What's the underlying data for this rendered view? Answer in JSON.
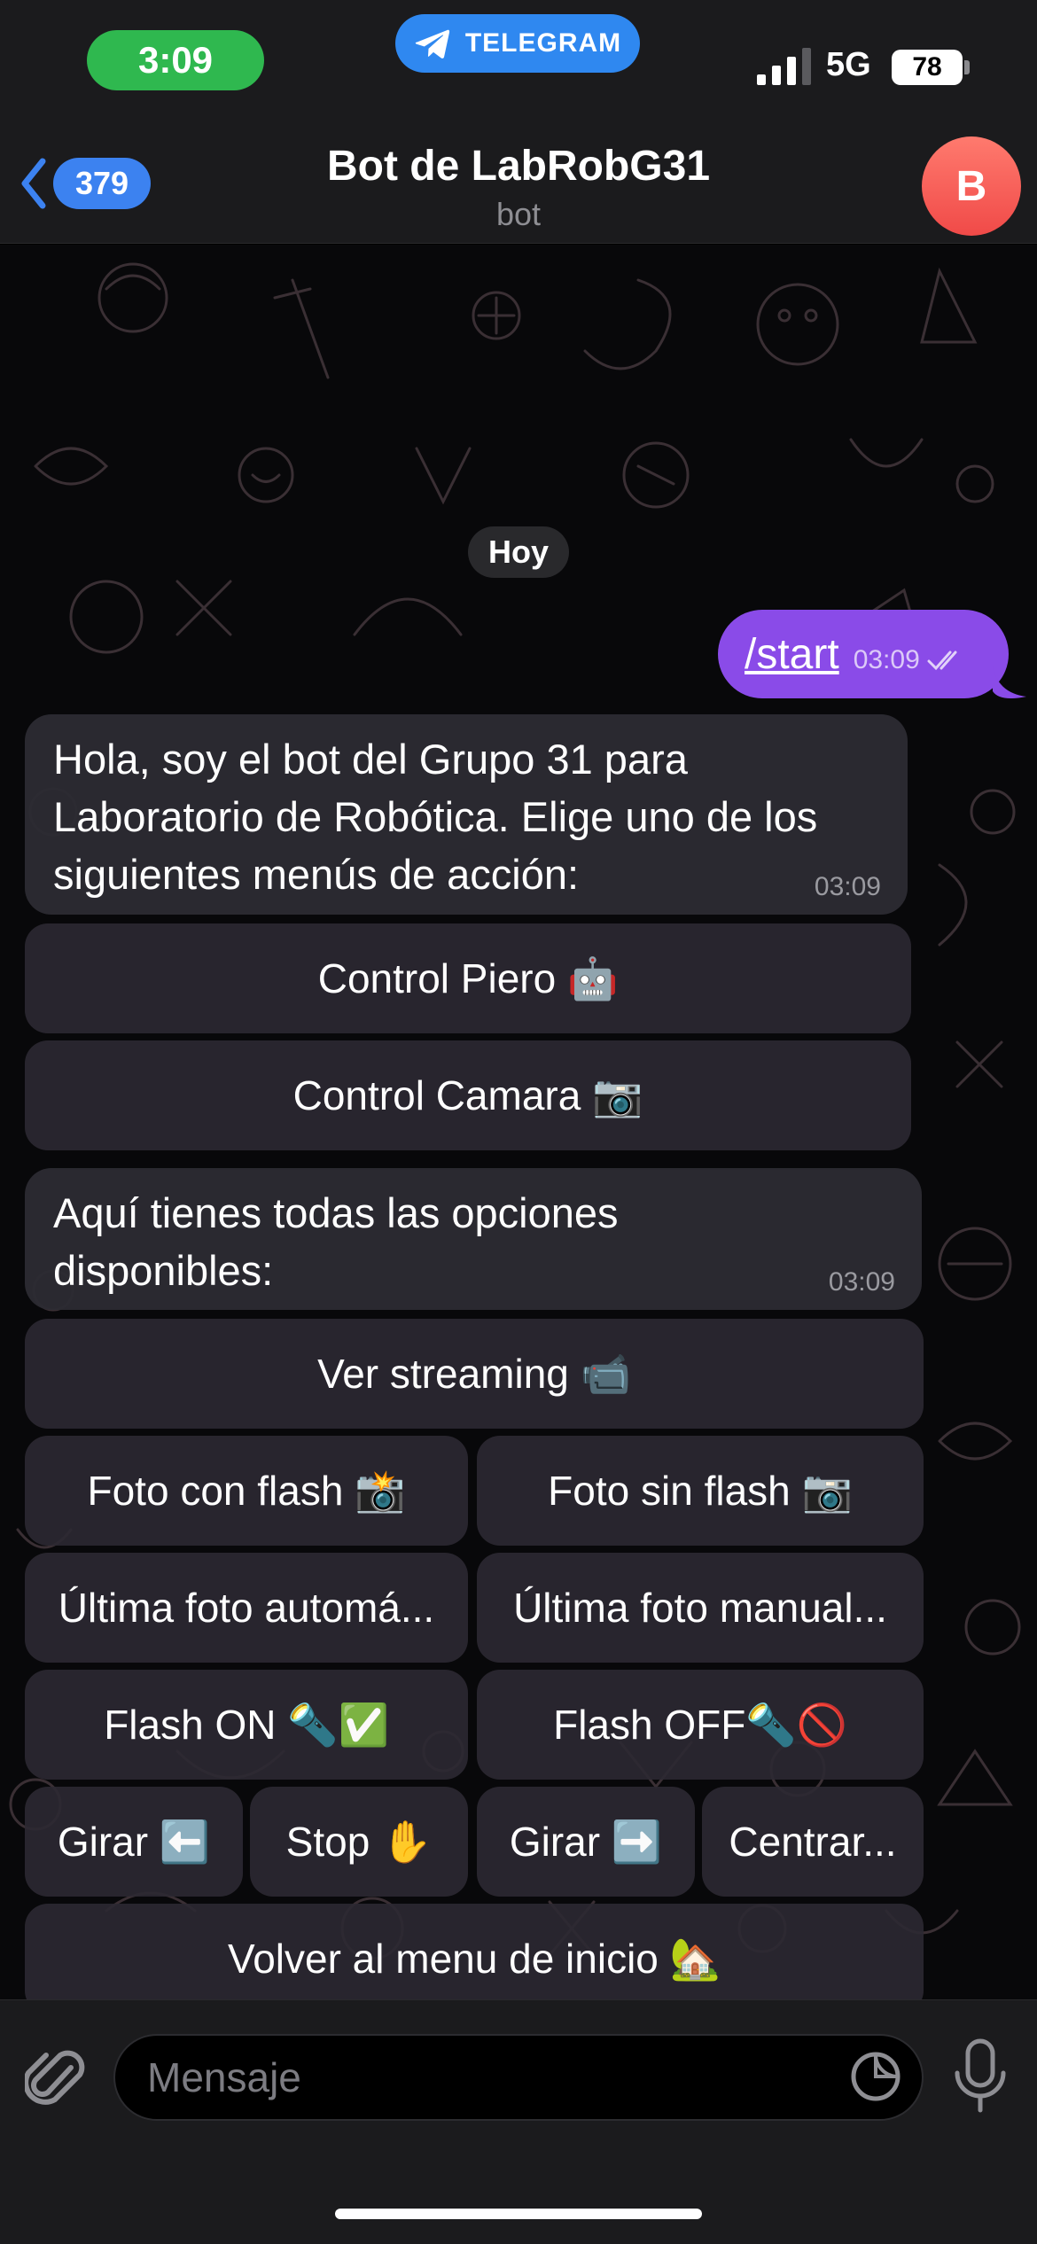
{
  "status": {
    "time": "3:09",
    "app_name": "TELEGRAM",
    "network": "5G",
    "battery": "78"
  },
  "header": {
    "back_count": "379",
    "title": "Bot de LabRobG31",
    "subtitle": "bot",
    "avatar_letter": "B"
  },
  "chat": {
    "date": "Hoy",
    "outgoing": {
      "text": "/start",
      "time": "03:09"
    },
    "incoming": [
      {
        "lines": [
          "Hola, soy el bot del Grupo 31 para",
          "Laboratorio de Robótica. Elige uno de los",
          "siguientes menús de acción:"
        ],
        "time": "03:09"
      },
      {
        "lines": [
          "Aquí tienes todas las opciones",
          "disponibles:"
        ],
        "time": "03:09"
      }
    ],
    "menu1_buttons": [
      "Control Piero 🤖",
      "Control Camara 📷"
    ],
    "menu2_buttons": {
      "streaming": "Ver streaming 📹",
      "foto_con_flash": "Foto con flash 📸",
      "foto_sin_flash": "Foto sin flash 📷",
      "ultima_auto": "Última foto automá...",
      "ultima_manual": "Última foto manual...",
      "flash_on": "Flash ON 🔦✅",
      "flash_off": "Flash OFF🔦🚫",
      "girar_izq": "Girar ⬅️",
      "stop": "Stop ✋",
      "girar_der": "Girar ➡️",
      "centrar": "Centrar...",
      "volver": "Volver al menu de inicio 🏡"
    }
  },
  "composer": {
    "placeholder": "Mensaje"
  },
  "colors": {
    "accent": "#3c82f0",
    "outgoing_bubble": "#8a4be8",
    "time_pill": "#2fb84f",
    "avatar": "#f04a48"
  }
}
